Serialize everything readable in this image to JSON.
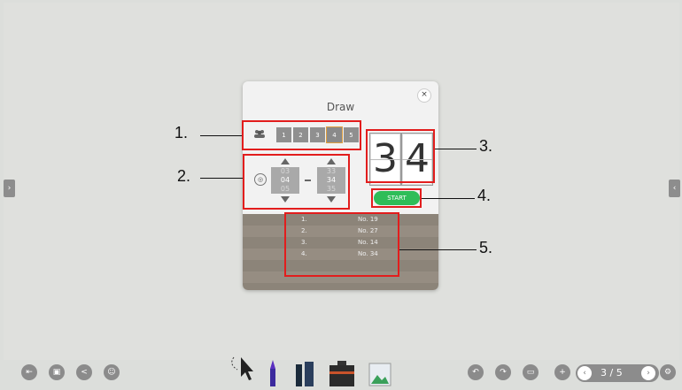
{
  "dialog": {
    "title": "Draw",
    "close_label": "×",
    "group_buttons": [
      "1",
      "2",
      "3",
      "4",
      "5"
    ],
    "range_min": {
      "prev": "03",
      "current": "04",
      "next": "05"
    },
    "range_max": {
      "prev": "33",
      "current": "34",
      "next": "35"
    },
    "range_separator": "–",
    "draw_digits": [
      "3",
      "4"
    ],
    "start_label": "START",
    "results": [
      {
        "index": "1.",
        "value": "No. 19"
      },
      {
        "index": "2.",
        "value": "No. 27"
      },
      {
        "index": "3.",
        "value": "No. 14"
      },
      {
        "index": "4.",
        "value": "No. 34"
      }
    ]
  },
  "callouts": [
    "1.",
    "2.",
    "3.",
    "4.",
    "5."
  ],
  "side_tabs": {
    "left": "›",
    "right": "‹"
  },
  "pager": {
    "text": "3 / 5",
    "prev": "‹",
    "next": "›"
  },
  "colors": {
    "start": "#2ebd58",
    "highlight": "#e21d1d",
    "selected_group": "#e0a040"
  }
}
